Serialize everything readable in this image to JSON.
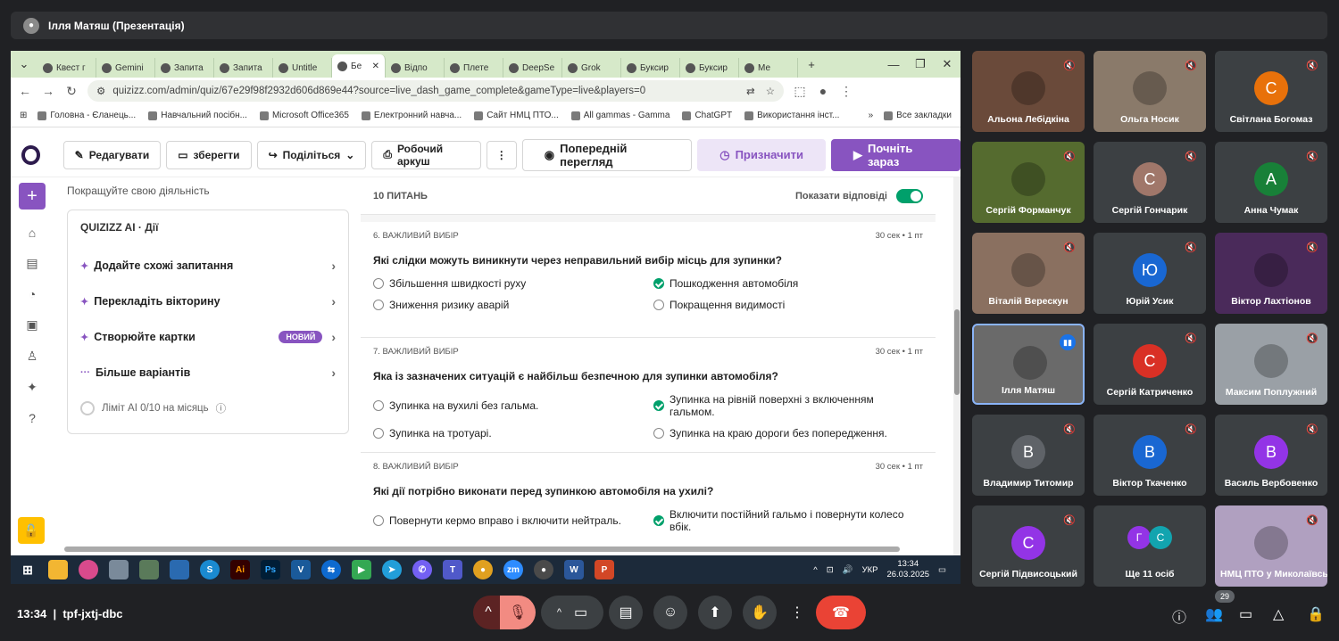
{
  "meeting": {
    "presenter_title": "Ілля Матяш (Презентація)",
    "time": "13:34",
    "code": "tpf-jxtj-dbc",
    "participants_count": "29"
  },
  "browser": {
    "tabs": [
      "Квест г",
      "Gemini",
      "Запита",
      "Запита",
      "Untitle",
      "Бе",
      "Відпо",
      "Плете",
      "DeepSe",
      "Grok",
      "Буксир",
      "Буксир",
      "Ме"
    ],
    "active_tab": 5,
    "url": "quizizz.com/admin/quiz/67e29f98f2932d606d869e44?source=live_dash_game_complete&gameType=live&players=0",
    "bookmarks": [
      "Головна - Єланець...",
      "Навчальний посібн...",
      "Microsoft Office365",
      "Електронний навча...",
      "Сайт НМЦ ПТО...",
      "All gammas - Gamma",
      "ChatGPT",
      "Використання інст..."
    ],
    "all_bookmarks": "Все закладки"
  },
  "toolbar": {
    "edit": "Редагувати",
    "save": "зберегти",
    "share": "Поділіться",
    "worksheet": "Робочий аркуш",
    "more": "⋮",
    "preview": "Попередній перегляд",
    "assign": "Призначити",
    "start": "Почніть зараз"
  },
  "left_panel": {
    "header": "Покращуйте свою діяльність",
    "brand": "QUIZIZZ AI · Дії",
    "actions": [
      {
        "label": "Додайте схожі запитання",
        "icon": "✦",
        "badge": ""
      },
      {
        "label": "Перекладіть вікторину",
        "icon": "✦",
        "badge": ""
      },
      {
        "label": "Створюйте картки",
        "icon": "✦",
        "badge": "НОВИЙ"
      },
      {
        "label": "Більше варіантів",
        "icon": "···",
        "badge": ""
      }
    ],
    "limit": "Ліміт AI 0/10 на місяць"
  },
  "quiz": {
    "count": "10 ПИТАНЬ",
    "show_answers": "Показати відповіді",
    "questions": [
      {
        "type": "6. ВАЖЛИВИЙ ВИБІР",
        "meta": "30 сек • 1 пт",
        "text": "Які слідки можуть виникнути через неправильний вибір місць для зупинки?",
        "options": [
          {
            "t": "Збільшення швидкості руху",
            "c": false
          },
          {
            "t": "Пошкодження автомобіля",
            "c": true
          },
          {
            "t": "Зниження ризику аварій",
            "c": false
          },
          {
            "t": "Покращення видимості",
            "c": false
          }
        ]
      },
      {
        "type": "7. ВАЖЛИВИЙ ВИБІР",
        "meta": "30 сек • 1 пт",
        "text": "Яка із зазначених ситуацій є найбільш безпечною для зупинки автомобіля?",
        "options": [
          {
            "t": "Зупинка на вухилі без гальма.",
            "c": false
          },
          {
            "t": "Зупинка на рівній поверхні з включенням гальмом.",
            "c": true
          },
          {
            "t": "Зупинка на тротуарі.",
            "c": false
          },
          {
            "t": "Зупинка на краю дороги без попередження.",
            "c": false
          }
        ]
      },
      {
        "type": "8. ВАЖЛИВИЙ ВИБІР",
        "meta": "30 сек • 1 пт",
        "text": "Які дії потрібно виконати перед зупинкою автомобіля на ухилі?",
        "options": [
          {
            "t": "Повернути кермо вправо і включити нейтраль.",
            "c": false
          },
          {
            "t": "Включити постійний гальмо і повернути колесо вбік.",
            "c": true
          }
        ]
      }
    ]
  },
  "taskbar": {
    "lang": "УКР",
    "time": "13:34",
    "date": "26.03.2025"
  },
  "participants": [
    {
      "name": "Альона Лебідкіна",
      "initial": "",
      "color": "#6a4a3a"
    },
    {
      "name": "Ольга Носик",
      "initial": "",
      "color": "#8a7a6a"
    },
    {
      "name": "Світлана Богомаз",
      "initial": "С",
      "color": "#e8710a"
    },
    {
      "name": "Сергій Форманчук",
      "initial": "",
      "color": "#556b2f"
    },
    {
      "name": "Сергій Гончарик",
      "initial": "С",
      "color": "#a0776a"
    },
    {
      "name": "Анна Чумак",
      "initial": "А",
      "color": "#188038"
    },
    {
      "name": "Віталій Верескун",
      "initial": "",
      "color": "#8a7060"
    },
    {
      "name": "Юрій Усик",
      "initial": "Ю",
      "color": "#1967d2"
    },
    {
      "name": "Віктор Лахтіонов",
      "initial": "",
      "color": "#4a2a5a"
    },
    {
      "name": "Ілля Матяш",
      "initial": "",
      "color": "#6a6a6a"
    },
    {
      "name": "Сергій Катриченко",
      "initial": "С",
      "color": "#d93025"
    },
    {
      "name": "Максим Поплужний",
      "initial": "",
      "color": "#9aa0a6"
    },
    {
      "name": "Владимир Титомир",
      "initial": "В",
      "color": "#5f6368"
    },
    {
      "name": "Віктор Ткаченко",
      "initial": "В",
      "color": "#1967d2"
    },
    {
      "name": "Василь Вербовенко",
      "initial": "В",
      "color": "#9334e6"
    },
    {
      "name": "Сергій Підвисоцький",
      "initial": "С",
      "color": "#9334e6"
    },
    {
      "name": "Ще 11 осіб",
      "initial": "",
      "color": ""
    },
    {
      "name": "НМЦ ПТО у Миколаївській",
      "initial": "",
      "color": "#b0a0c0"
    }
  ],
  "others": {
    "a": "Г",
    "b": "С"
  }
}
